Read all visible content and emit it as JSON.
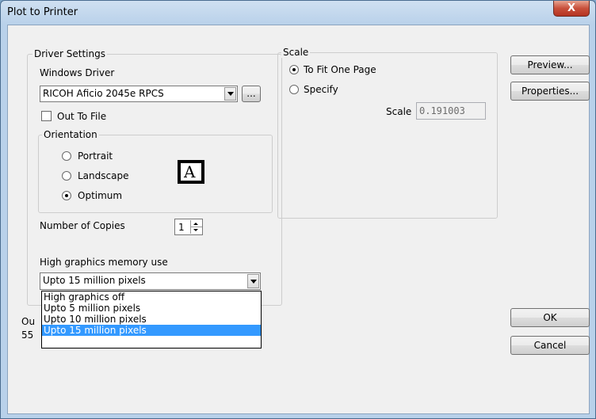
{
  "window": {
    "title": "Plot to Printer",
    "close_glyph": "X"
  },
  "driver": {
    "group_title": "Driver Settings",
    "windows_driver_label": "Windows Driver",
    "printer_value": "RICOH Aficio 2045e RPCS",
    "browse_label": "...",
    "out_to_file_label": "Out To File",
    "out_to_file_checked": false
  },
  "orientation": {
    "group_title": "Orientation",
    "options": [
      "Portrait",
      "Landscape",
      "Optimum"
    ],
    "selected": "Optimum",
    "preview_glyph": "A"
  },
  "copies": {
    "label": "Number of Copies",
    "value": "1"
  },
  "graphics": {
    "label": "High graphics memory use",
    "value": "Upto 15 million pixels",
    "options": [
      "High graphics off",
      "Upto 5 million pixels",
      "Upto 10 million pixels",
      "Upto 15 million pixels"
    ],
    "selected_index": 3
  },
  "hidden_fragments": {
    "line1": "Ou",
    "line2": "55"
  },
  "scale": {
    "group_title": "Scale",
    "fit_label": "To Fit One Page",
    "specify_label": "Specify",
    "selected": "To Fit One Page",
    "scale_label": "Scale",
    "scale_value": "0.191003"
  },
  "buttons": {
    "preview": "Preview...",
    "properties": "Properties...",
    "ok": "OK",
    "cancel": "Cancel"
  }
}
